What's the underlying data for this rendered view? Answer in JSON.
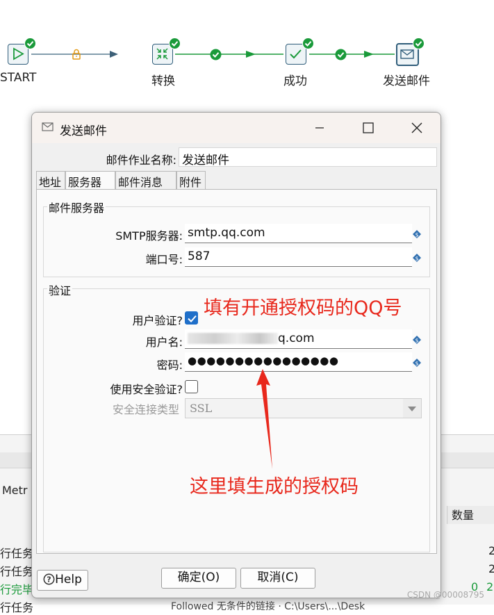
{
  "workflow": {
    "nodes": [
      {
        "label": "START",
        "icon": "play-icon"
      },
      {
        "label": "转换",
        "icon": "transform-icon"
      },
      {
        "label": "成功",
        "icon": "check-icon"
      },
      {
        "label": "发送邮件",
        "icon": "mail-icon"
      }
    ]
  },
  "background": {
    "left_texts": [
      "Metr",
      "行任务",
      "行任务",
      "行完毕",
      "行任务"
    ],
    "right_header": "数量",
    "right_values": [
      "2",
      "2",
      "0",
      "2",
      "2"
    ],
    "row_tail": "Followed 无条件的链接 · C:\\Users\\...\\Desk"
  },
  "dialog": {
    "title": "发送邮件",
    "job_name_label": "邮件作业名称:",
    "job_name_value": "发送邮件",
    "tabs": [
      "地址",
      "服务器",
      "邮件消息",
      "附件"
    ],
    "server_group": {
      "title": "邮件服务器",
      "smtp_label": "SMTP服务器:",
      "smtp_value": "smtp.qq.com",
      "port_label": "端口号:",
      "port_value": "587"
    },
    "auth_group": {
      "title": "验证",
      "user_auth_label": "用户验证?",
      "user_auth_checked": true,
      "username_label": "用户名:",
      "username_value": "q.com",
      "password_label": "密码:",
      "password_value": "●●●●●●●●●●●●●●●●",
      "secure_label": "使用安全验证?",
      "secure_checked": false,
      "conn_type_label": "安全连接类型",
      "conn_type_value": "SSL"
    },
    "help_label": "Help",
    "ok_label": "确定(O)",
    "cancel_label": "取消(C)"
  },
  "annotations": {
    "qq_hint": "填有开通授权码的QQ号",
    "code_hint": "这里填生成的授权码"
  },
  "watermark": "CSDN @00008795",
  "colors": {
    "annotation_red": "#e8281c",
    "success_green": "#1a9a3a",
    "checkbox_blue": "#1f6fc9",
    "lock_orange": "#e39a16"
  }
}
